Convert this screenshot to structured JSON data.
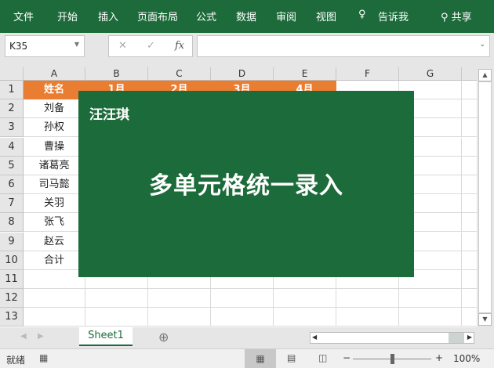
{
  "ribbon": {
    "tabs": [
      "文件",
      "开始",
      "插入",
      "页面布局",
      "公式",
      "数据",
      "审阅",
      "视图"
    ],
    "tell_me": "告诉我",
    "share": "共享"
  },
  "formula_bar": {
    "name_box": "K35",
    "formula": ""
  },
  "columns": [
    "A",
    "B",
    "C",
    "D",
    "E",
    "F",
    "G"
  ],
  "rows": [
    "1",
    "2",
    "3",
    "4",
    "5",
    "6",
    "7",
    "8",
    "9",
    "10",
    "11",
    "12",
    "13"
  ],
  "header_row": [
    "姓名",
    "1月",
    "2月",
    "3月",
    "4月"
  ],
  "names": [
    "刘备",
    "孙权",
    "曹操",
    "诸葛亮",
    "司马懿",
    "关羽",
    "张飞",
    "赵云",
    "合计"
  ],
  "overlay": {
    "brand": "汪汪琪",
    "title": "多单元格统一录入",
    "color": "#1c6b3a"
  },
  "sheet_tab": "Sheet1",
  "status": {
    "ready": "就绪",
    "zoom": "100%"
  },
  "colors": {
    "ribbon": "#1d6b3b",
    "header_fill": "#e97d31"
  }
}
